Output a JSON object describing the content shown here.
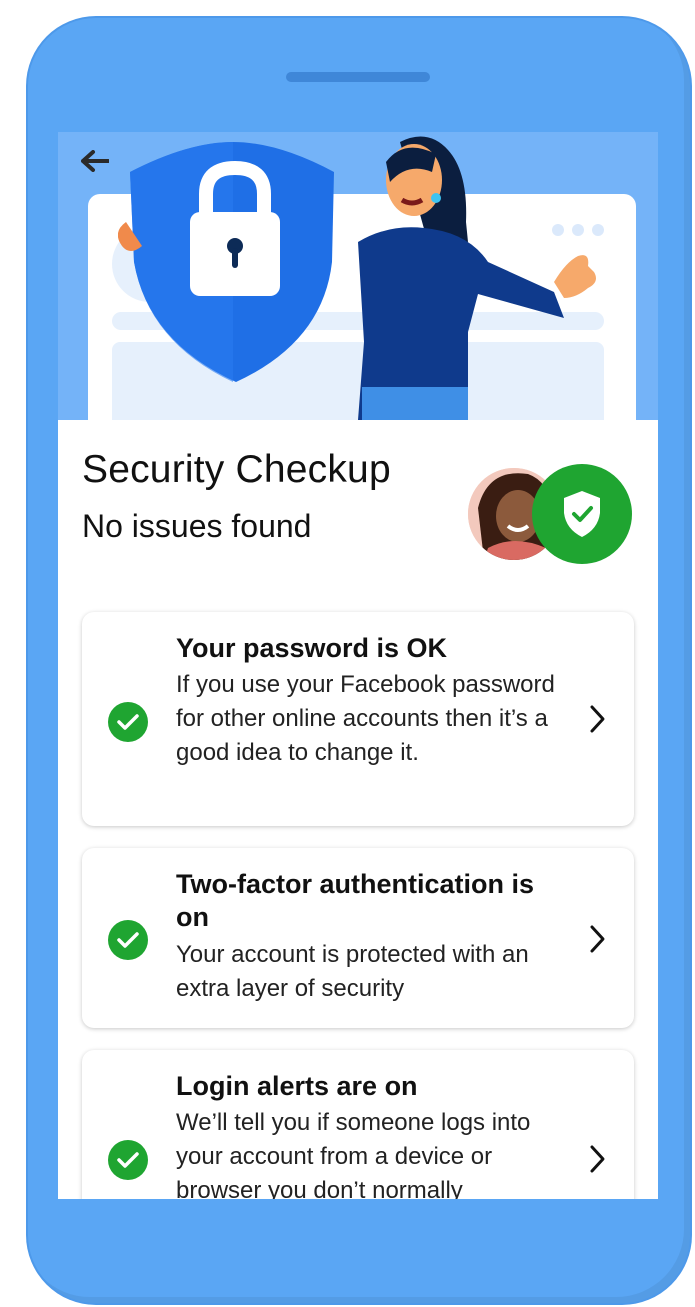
{
  "header": {
    "back_icon": "arrow-left-icon"
  },
  "page": {
    "title": "Security Checkup",
    "subtitle": "No issues found",
    "status_icon": "shield-check-icon"
  },
  "items": [
    {
      "title": "Your password is OK",
      "body": "If you use your Facebook password for other online accounts then it’s a good idea to change it.",
      "status": "ok",
      "icon": "check-circle-icon"
    },
    {
      "title": "Two-factor authentication is on",
      "body": "Your account is protected with an extra layer of security",
      "status": "ok",
      "icon": "check-circle-icon"
    },
    {
      "title": "Login alerts are on",
      "body": "We’ll tell you if someone logs into your account from a device or browser you don’t normally",
      "status": "ok",
      "icon": "check-circle-icon"
    }
  ],
  "colors": {
    "device_frame": "#5aa6f4",
    "hero_background": "#74b3f8",
    "shield_blue": "#1f6fe6",
    "success_green": "#1fa531",
    "text": "#111111"
  }
}
